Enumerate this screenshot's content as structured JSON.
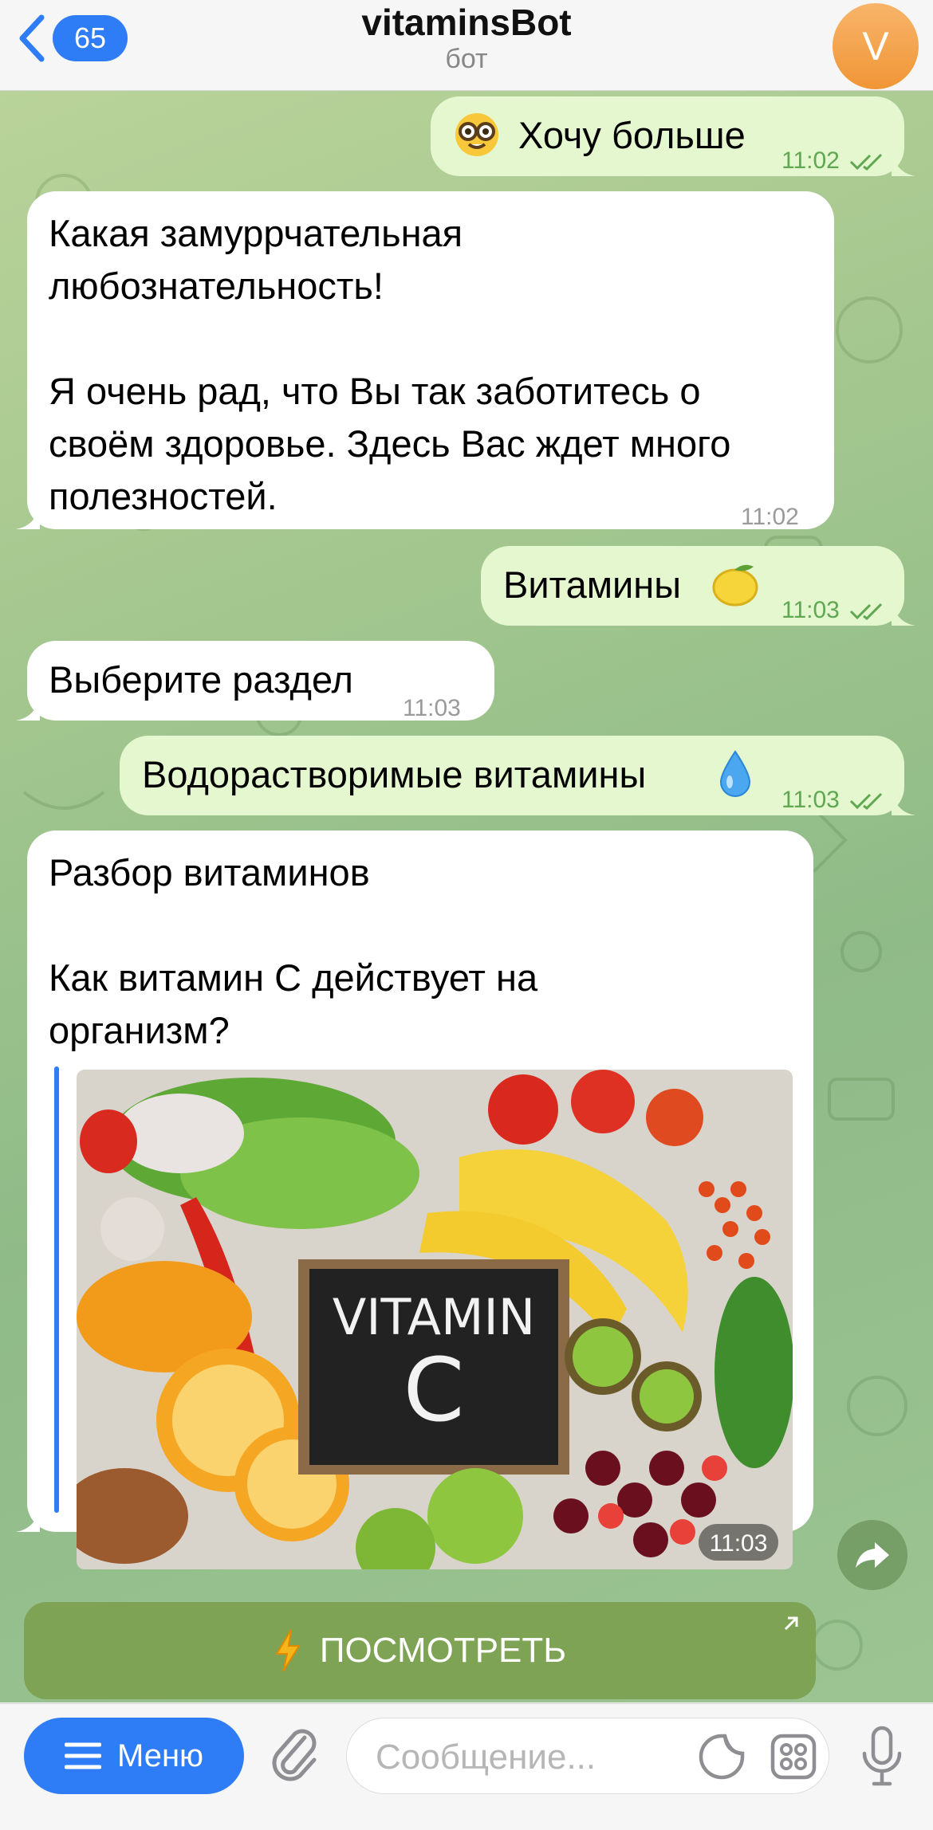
{
  "header": {
    "back_count": "65",
    "title": "vitaminsBot",
    "subtitle": "бот",
    "avatar_letter": "V"
  },
  "messages": [
    {
      "id": 0,
      "direction": "outgoing",
      "emoji": "nerd-face",
      "text": "Хочу больше",
      "time": "11:02"
    },
    {
      "id": 1,
      "direction": "incoming",
      "lines": [
        "Какая замуррчательная",
        "любознательность!",
        "",
        "Я очень рад, что Вы так заботитесь о",
        "своём здоровье. Здесь Вас ждет много",
        "полезностей."
      ],
      "time": "11:02"
    },
    {
      "id": 2,
      "direction": "outgoing",
      "text": "Витамины",
      "emoji": "lemon",
      "time": "11:03"
    },
    {
      "id": 3,
      "direction": "incoming",
      "text": "Выберите раздел",
      "time": "11:03"
    },
    {
      "id": 4,
      "direction": "outgoing",
      "text": "Водорастворимые витамины",
      "emoji": "droplet",
      "time": "11:03"
    },
    {
      "id": 5,
      "direction": "incoming",
      "lines": [
        "Разбор витаминов",
        "",
        "Как витамин С действует на",
        "организм?"
      ],
      "image": {
        "sign_line1": "VITAMIN",
        "sign_line2": "C"
      },
      "time": "11:03"
    }
  ],
  "inline_button": {
    "icon": "lightning-icon",
    "label": "ПОСМОТРЕТЬ"
  },
  "input_bar": {
    "menu_label": "Меню",
    "placeholder": "Сообщение..."
  },
  "colors": {
    "accent": "#2f7df6",
    "outgoing_bubble": "#e4f7cf",
    "incoming_bubble": "#ffffff",
    "inline_button": "#7ea355",
    "avatar": "#f2a24a"
  }
}
